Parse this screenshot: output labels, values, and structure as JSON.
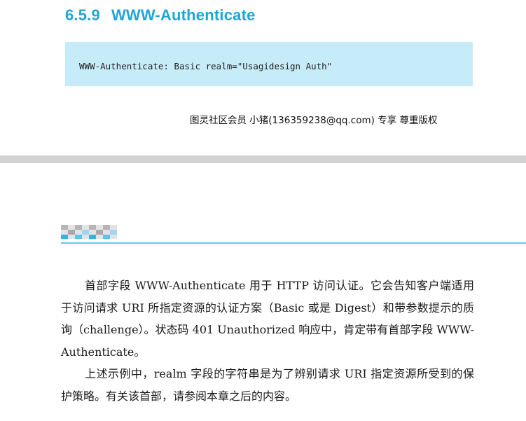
{
  "section": {
    "number": "6.5.9",
    "title": "WWW-Authenticate"
  },
  "code_example": "WWW-Authenticate: Basic realm=\"Usagidesign Auth\"",
  "watermark": "图灵社区会员 小猪(136359238@qq.com) 专享 尊重版权",
  "paragraphs": [
    "首部字段 WWW-Authenticate 用于 HTTP 访问认证。它会告知客户端适用于访问请求 URI 所指定资源的认证方案（Basic 或是 Digest）和带参数提示的质询（challenge）。状态码 401 Unauthorized 响应中，肯定带有首部字段 WWW-Authenticate。",
    "上述示例中，realm 字段的字符串是为了辨别请求 URI 指定资源所受到的保护策略。有关该首部，请参阅本章之后的内容。"
  ],
  "colors": {
    "heading": "#1fa6d6",
    "code_background": "#c7ecf9",
    "page_break": "#d2d2d2",
    "accent_line": "#63c9ee"
  }
}
